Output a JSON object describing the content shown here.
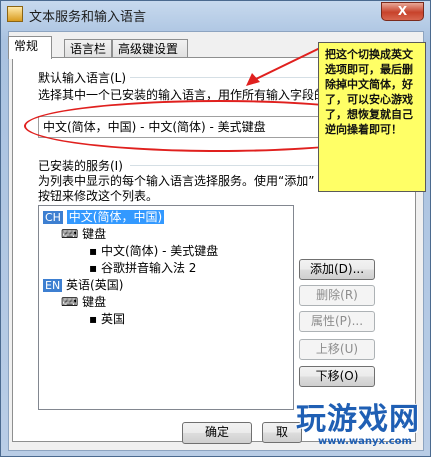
{
  "window": {
    "title": "文本服务和输入语言",
    "close_glyph": "X"
  },
  "tabs": [
    {
      "label": "常规",
      "active": true
    },
    {
      "label": "语言栏",
      "active": false
    },
    {
      "label": "高级键设置",
      "active": false
    }
  ],
  "default_input": {
    "heading": "默认输入语言(L)",
    "description": "选择其中一个已安装的输入语言，用作所有输入字段的",
    "selected_value": "中文(简体，中国) - 中文(简体) - 美式键盘"
  },
  "installed_services": {
    "heading": "已安装的服务(I)",
    "description_line1": "为列表中显示的每个输入语言选择服务。使用“添加”",
    "description_line2": "按钮来修改这个列表。"
  },
  "tree": {
    "languages": [
      {
        "code": "CH",
        "label": "中文(简体，中国)",
        "selected": true,
        "group": "键盘",
        "items": [
          "中文(简体) - 美式键盘",
          "谷歌拼音输入法 2"
        ]
      },
      {
        "code": "EN",
        "label": "英语(英国)",
        "selected": false,
        "group": "键盘",
        "items": [
          "英国"
        ]
      }
    ]
  },
  "buttons": {
    "add": "添加(D)...",
    "remove": "删除(R)",
    "properties": "属性(P)...",
    "move_up": "上移(U)",
    "move_down": "下移(O)",
    "ok": "确定",
    "cancel_partial": "取"
  },
  "annotation": {
    "text": "把这个切换成英文选项即可，最后删除掉中文简体，好了，可以安心游戏了，想恢复就自己逆向操着即可！",
    "arrow_color": "#e0201e",
    "bg_color": "#ffff66"
  },
  "watermark": {
    "brand": "玩游戏网",
    "url": "www.wanyx.com"
  }
}
